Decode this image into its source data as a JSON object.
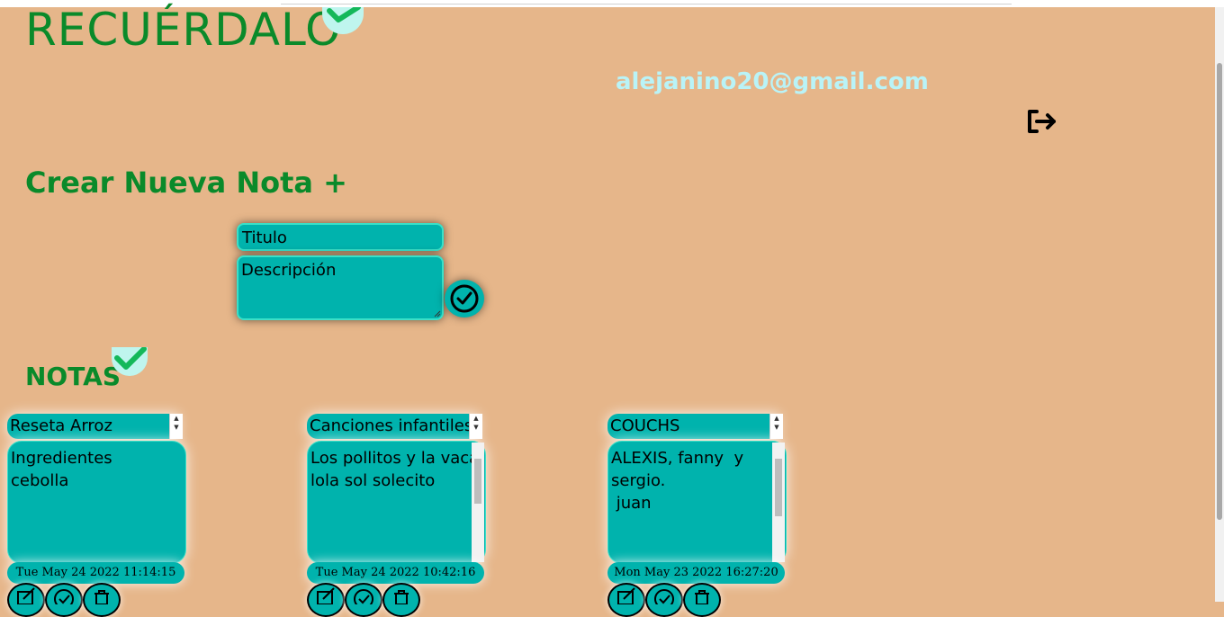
{
  "app": {
    "title": "RECUÉRDALO",
    "user_email": "alejanino20@gmail.com"
  },
  "create": {
    "heading": "Crear Nueva Nota +",
    "title_placeholder": "Titulo",
    "description_placeholder": "Descripción"
  },
  "notes_section": {
    "heading": "NOTAS"
  },
  "notes": [
    {
      "title": "Reseta Arroz",
      "body": "Ingredientes\ncebolla",
      "date": "Tue May 24 2022 11:14:15"
    },
    {
      "title": "Canciones infantiles",
      "body": "Los pollitos y la vaca\nlola sol solecito",
      "date": "Tue May 24 2022 10:42:16"
    },
    {
      "title": "COUCHS",
      "body": "ALEXIS, fanny  y\nsergio.\n juan",
      "date": "Mon May 23 2022 16:27:20"
    }
  ],
  "colors": {
    "background": "#e6b68a",
    "accent_teal": "#00b3ad",
    "heading_green": "#0a8a2a",
    "email_color": "#b9f3f7"
  },
  "icons": {
    "logout": "logout-icon",
    "submit": "check-circle-icon",
    "edit": "edit-icon",
    "done": "check-circle-icon",
    "delete": "trash-icon"
  }
}
